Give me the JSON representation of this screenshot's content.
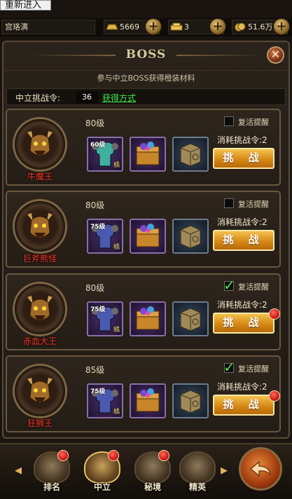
{
  "browser": {
    "reload_label": "重新进入"
  },
  "topbar": {
    "player_name": "宫珞满",
    "resources": [
      {
        "icon": "gold-ingot-icon",
        "value": "5669"
      },
      {
        "icon": "gold-bar-icon",
        "value": "3"
      },
      {
        "icon": "coin-icon",
        "value": "51.6万"
      }
    ]
  },
  "panel": {
    "title": "BOSS",
    "subtitle": "参与中立BOSS获得橙装材料",
    "ticket_label": "中立挑战令:",
    "ticket_value": "36",
    "ticket_link": "获得方式"
  },
  "bosses": [
    {
      "name": "牛魔王",
      "level": "80级",
      "revive_checked": false,
      "item_level": "60级",
      "item_tag": "橘",
      "cost": "消耗挑战令:2",
      "fight": "挑 战",
      "badge": false
    },
    {
      "name": "巨斧熊怪",
      "level": "80级",
      "revive_checked": false,
      "item_level": "75级",
      "item_tag": "橘",
      "cost": "消耗挑战令:2",
      "fight": "挑 战",
      "badge": false
    },
    {
      "name": "赤血大王",
      "level": "80级",
      "revive_checked": true,
      "item_level": "75级",
      "item_tag": "橘",
      "cost": "消耗挑战令:2",
      "fight": "挑 战",
      "badge": true
    },
    {
      "name": "狂狮王",
      "level": "85级",
      "revive_checked": true,
      "item_level": "75级",
      "item_tag": "橘",
      "cost": "消耗挑战令:2",
      "fight": "挑 战",
      "badge": true
    }
  ],
  "revive_label": "复活提醒",
  "nav": {
    "items": [
      {
        "label": "排名",
        "badge": true,
        "active": false
      },
      {
        "label": "中立",
        "badge": true,
        "active": true
      },
      {
        "label": "秘境",
        "badge": true,
        "active": false
      },
      {
        "label": "精英",
        "badge": false,
        "active": false
      }
    ]
  },
  "colors": {
    "accent_gold": "#d48512",
    "boss_name_red": "#ff3b2a",
    "link_green": "#3ee84a"
  }
}
